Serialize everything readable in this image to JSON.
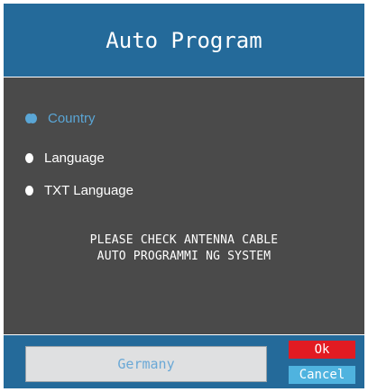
{
  "dialog": {
    "title": "Auto Program"
  },
  "menu": {
    "items": [
      {
        "label": "Country",
        "selected": true
      },
      {
        "label": "Language",
        "selected": false
      },
      {
        "label": "TXT Language",
        "selected": false
      }
    ]
  },
  "message": {
    "line1": "PLEASE CHECK ANTENNA CABLE",
    "line2": "AUTO PROGRAMMI NG SYSTEM"
  },
  "footer": {
    "value": "Germany",
    "ok_label": "Ok",
    "cancel_label": "Cancel"
  },
  "colors": {
    "header_bg": "#246a9a",
    "body_bg": "#4a4a4a",
    "accent": "#5aa6d6",
    "ok_button": "#e11b22",
    "cancel_button": "#4fb3df"
  }
}
